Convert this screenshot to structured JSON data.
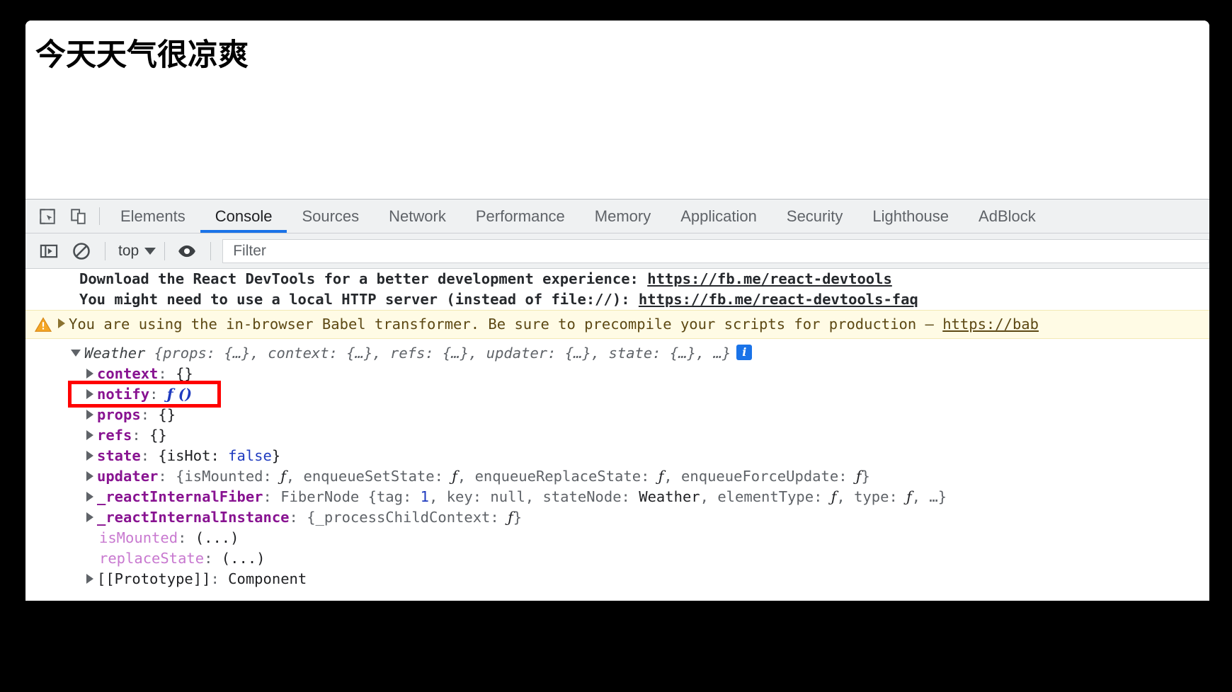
{
  "page": {
    "heading": "今天天气很凉爽"
  },
  "devtools": {
    "toolbar_icons": [
      {
        "name": "inspect-element-icon",
        "title": "Inspect element"
      },
      {
        "name": "device-toolbar-icon",
        "title": "Toggle device toolbar"
      }
    ],
    "tabs": [
      {
        "label": "Elements",
        "active": false
      },
      {
        "label": "Console",
        "active": true
      },
      {
        "label": "Sources",
        "active": false
      },
      {
        "label": "Network",
        "active": false
      },
      {
        "label": "Performance",
        "active": false
      },
      {
        "label": "Memory",
        "active": false
      },
      {
        "label": "Application",
        "active": false
      },
      {
        "label": "Security",
        "active": false
      },
      {
        "label": "Lighthouse",
        "active": false
      },
      {
        "label": "AdBlock",
        "active": false
      }
    ],
    "active_tab_accent": "#1a73e8"
  },
  "console_toolbar": {
    "sidebar_toggle_icon": "console-sidebar-icon",
    "clear_icon": "clear-console-icon",
    "context_label": "top",
    "context_caret": "chevron-down-icon",
    "eye_icon": "live-expression-eye-icon",
    "filter_placeholder": "Filter"
  },
  "console": {
    "messages": [
      {
        "kind": "log",
        "text_before": "Download the React DevTools for a better development experience: ",
        "link": "https://fb.me/react-devtools"
      },
      {
        "kind": "log",
        "text_before": "You might need to use a local HTTP server (instead of file://): ",
        "link": "https://fb.me/react-devtools-faq"
      }
    ],
    "warning": {
      "icon": "warning-triangle-icon",
      "arrow": "disclosure-triangle-collapsed",
      "text_before": "You are using the in-browser Babel transformer. Be sure to precompile your scripts for production — ",
      "link": "https://bab",
      "bg_color": "#fffbe5",
      "text_color": "#5c4813"
    },
    "object": {
      "arrow": "disclosure-triangle-expanded",
      "class_name": "Weather",
      "preview": " {props: {…}, context: {…}, refs: {…}, updater: {…}, state: {…}, …}",
      "info_badge": "i",
      "properties": [
        {
          "arrow": true,
          "name": "context",
          "style": "key",
          "sep": ": ",
          "value": "{}"
        },
        {
          "arrow": true,
          "name": "notify",
          "style": "key",
          "sep": ": ",
          "value": "ƒ ()",
          "value_style": "fn-blue",
          "highlighted": true
        },
        {
          "arrow": true,
          "name": "props",
          "style": "key",
          "sep": ": ",
          "value": "{}"
        },
        {
          "arrow": true,
          "name": "refs",
          "style": "key",
          "sep": ": ",
          "value": "{}"
        },
        {
          "arrow": true,
          "name": "state",
          "style": "key",
          "sep": ": ",
          "value": "{isHot: false}"
        },
        {
          "arrow": true,
          "name": "updater",
          "style": "key",
          "sep": ": ",
          "value": "{isMounted: ƒ, enqueueSetState: ƒ, enqueueReplaceState: ƒ, enqueueForceUpdate: ƒ}"
        },
        {
          "arrow": true,
          "name": "_reactInternalFiber",
          "style": "key",
          "sep": ": ",
          "value": "FiberNode {tag: 1, key: null, stateNode: Weather, elementType: ƒ, type: ƒ, …}"
        },
        {
          "arrow": true,
          "name": "_reactInternalInstance",
          "style": "key",
          "sep": ": ",
          "value": "{_processChildContext: ƒ}"
        },
        {
          "arrow": false,
          "name": "isMounted",
          "style": "getter",
          "sep": ": ",
          "value": "(...)"
        },
        {
          "arrow": false,
          "name": "replaceState",
          "style": "getter",
          "sep": ": ",
          "value": "(...)"
        },
        {
          "arrow": true,
          "name": "[[Prototype]]",
          "style": "plain",
          "sep": ": ",
          "value": "Component"
        }
      ]
    },
    "annotation": {
      "name": "red-highlight-box",
      "color": "#ff0000",
      "target": "notify"
    }
  }
}
